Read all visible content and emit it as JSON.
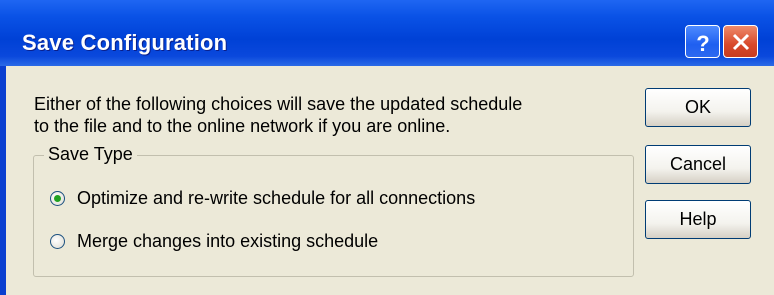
{
  "dialog": {
    "title": "Save Configuration",
    "title_buttons": {
      "help_icon": "question-mark-icon",
      "close_icon": "close-x-icon"
    },
    "message_lines": [
      "Either of the following choices will save the updated schedule",
      "to the file and to the online network if you are online."
    ],
    "save_type": {
      "label": "Save Type",
      "options": [
        {
          "label": "Optimize and re-write schedule for all connections",
          "selected": true
        },
        {
          "label": "Merge changes into existing schedule",
          "selected": false
        }
      ]
    },
    "buttons": {
      "ok": "OK",
      "cancel": "Cancel",
      "help": "Help"
    }
  },
  "colors": {
    "titlebar": "#0a52e6",
    "client": "#ece9d8",
    "close_button": "#d8482a",
    "radio_selected": "#21a121"
  }
}
